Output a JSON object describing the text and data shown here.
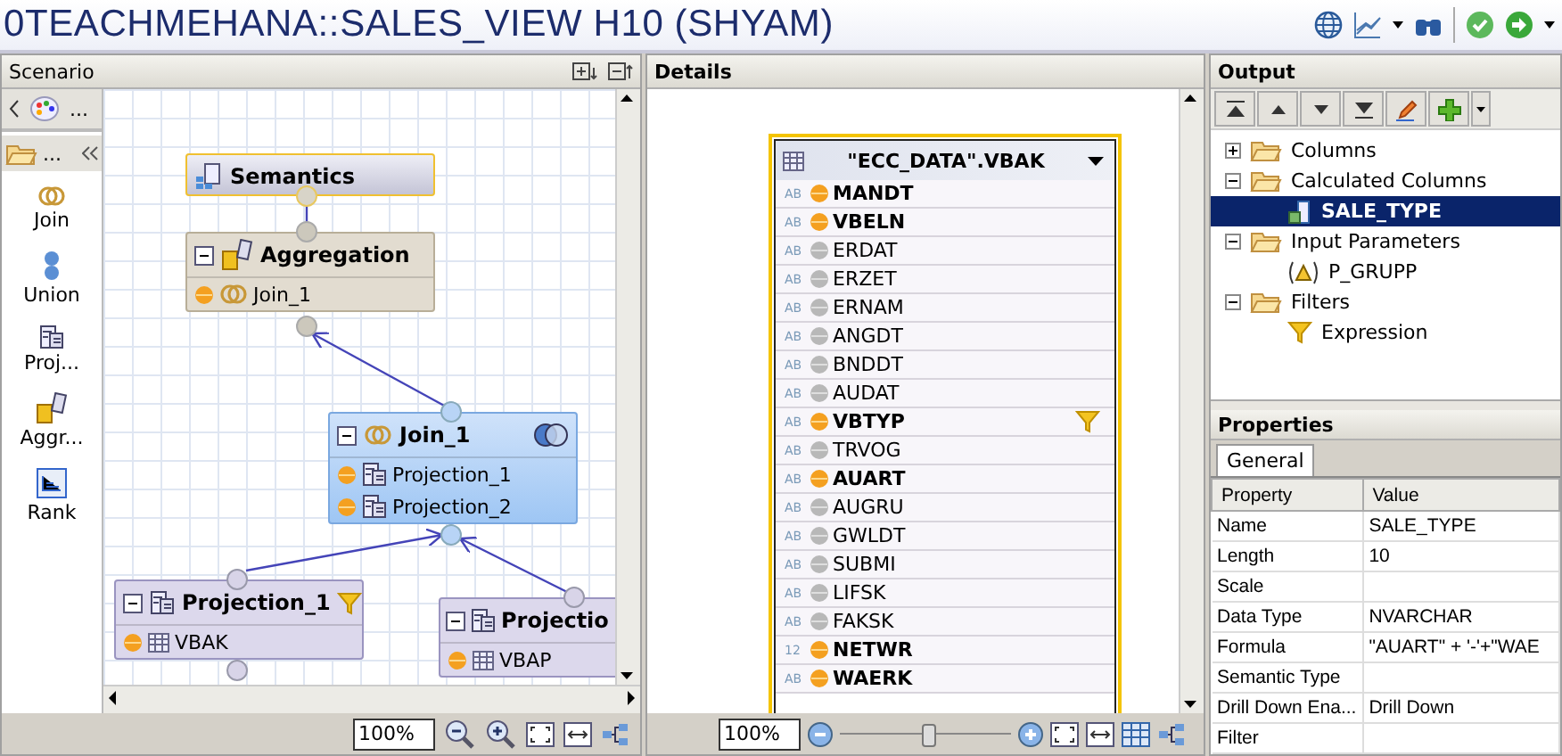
{
  "window": {
    "title": "0TEACHMEHANA::SALES_VIEW H10 (SHYAM)"
  },
  "scenario": {
    "title": "Scenario",
    "palette_more": "...",
    "palette_folder": "...",
    "palette": [
      {
        "kind": "join",
        "label": "Join"
      },
      {
        "kind": "union",
        "label": "Union"
      },
      {
        "kind": "projection",
        "label": "Proj..."
      },
      {
        "kind": "aggregation",
        "label": "Aggr..."
      },
      {
        "kind": "rank",
        "label": "Rank"
      }
    ],
    "nodes": [
      {
        "kind": "semantics",
        "title": "Semantics",
        "selected": true
      },
      {
        "kind": "aggregation",
        "title": "Aggregation",
        "selected": false,
        "inputs": [
          {
            "kind": "join",
            "label": "Join_1"
          }
        ]
      },
      {
        "kind": "join",
        "title": "Join_1",
        "selected": false,
        "inputs": [
          {
            "kind": "projection",
            "label": "Projection_1"
          },
          {
            "kind": "projection",
            "label": "Projection_2"
          }
        ]
      },
      {
        "kind": "projection",
        "title": "Projection_1",
        "selected": false,
        "filter": true,
        "inputs": [
          {
            "kind": "table",
            "label": "VBAK"
          }
        ]
      },
      {
        "kind": "projection",
        "title": "Projectio",
        "selected": false,
        "inputs": [
          {
            "kind": "table",
            "label": "VBAP"
          }
        ]
      }
    ],
    "zoom": "100%"
  },
  "details": {
    "title": "Details",
    "table": "\"ECC_DATA\".VBAK",
    "fields": [
      {
        "type": "AB",
        "name": "MANDT",
        "selected": true
      },
      {
        "type": "AB",
        "name": "VBELN",
        "selected": true
      },
      {
        "type": "AB",
        "name": "ERDAT",
        "selected": false
      },
      {
        "type": "AB",
        "name": "ERZET",
        "selected": false
      },
      {
        "type": "AB",
        "name": "ERNAM",
        "selected": false
      },
      {
        "type": "AB",
        "name": "ANGDT",
        "selected": false
      },
      {
        "type": "AB",
        "name": "BNDDT",
        "selected": false
      },
      {
        "type": "AB",
        "name": "AUDAT",
        "selected": false
      },
      {
        "type": "AB",
        "name": "VBTYP",
        "selected": true,
        "filter": true
      },
      {
        "type": "AB",
        "name": "TRVOG",
        "selected": false
      },
      {
        "type": "AB",
        "name": "AUART",
        "selected": true
      },
      {
        "type": "AB",
        "name": "AUGRU",
        "selected": false
      },
      {
        "type": "AB",
        "name": "GWLDT",
        "selected": false
      },
      {
        "type": "AB",
        "name": "SUBMI",
        "selected": false
      },
      {
        "type": "AB",
        "name": "LIFSK",
        "selected": false
      },
      {
        "type": "AB",
        "name": "FAKSK",
        "selected": false
      },
      {
        "type": "12",
        "name": "NETWR",
        "selected": true
      },
      {
        "type": "AB",
        "name": "WAERK",
        "selected": true
      }
    ],
    "zoom": "100%",
    "zoom_slider": {
      "level": 0.52
    }
  },
  "output": {
    "title": "Output",
    "tree": [
      {
        "label": "Columns",
        "expanded": false
      },
      {
        "label": "Calculated Columns",
        "expanded": true,
        "children": [
          {
            "kind": "calculated",
            "label": "SALE_TYPE",
            "selected": true
          }
        ]
      },
      {
        "label": "Input Parameters",
        "expanded": true,
        "children": [
          {
            "kind": "parameter",
            "label": "P_GRUPP",
            "selected": false
          }
        ]
      },
      {
        "label": "Filters",
        "expanded": true,
        "children": [
          {
            "kind": "filter",
            "label": "Expression",
            "selected": false
          }
        ]
      }
    ]
  },
  "properties": {
    "title": "Properties",
    "tabs": [
      {
        "label": "General",
        "selected": true
      }
    ],
    "columns": [
      "Property",
      "Value"
    ],
    "rows": [
      {
        "property": "Name",
        "value": "SALE_TYPE"
      },
      {
        "property": "Length",
        "value": "10"
      },
      {
        "property": "Scale"
      },
      {
        "property": "Data Type",
        "value": "NVARCHAR"
      },
      {
        "property": "Formula",
        "value": "\"AUART\" + '-'+\"WAE"
      },
      {
        "property": "Semantic Type"
      },
      {
        "property": "Drill Down Ena...",
        "value": "Drill Down"
      },
      {
        "property": "Filter"
      }
    ]
  }
}
